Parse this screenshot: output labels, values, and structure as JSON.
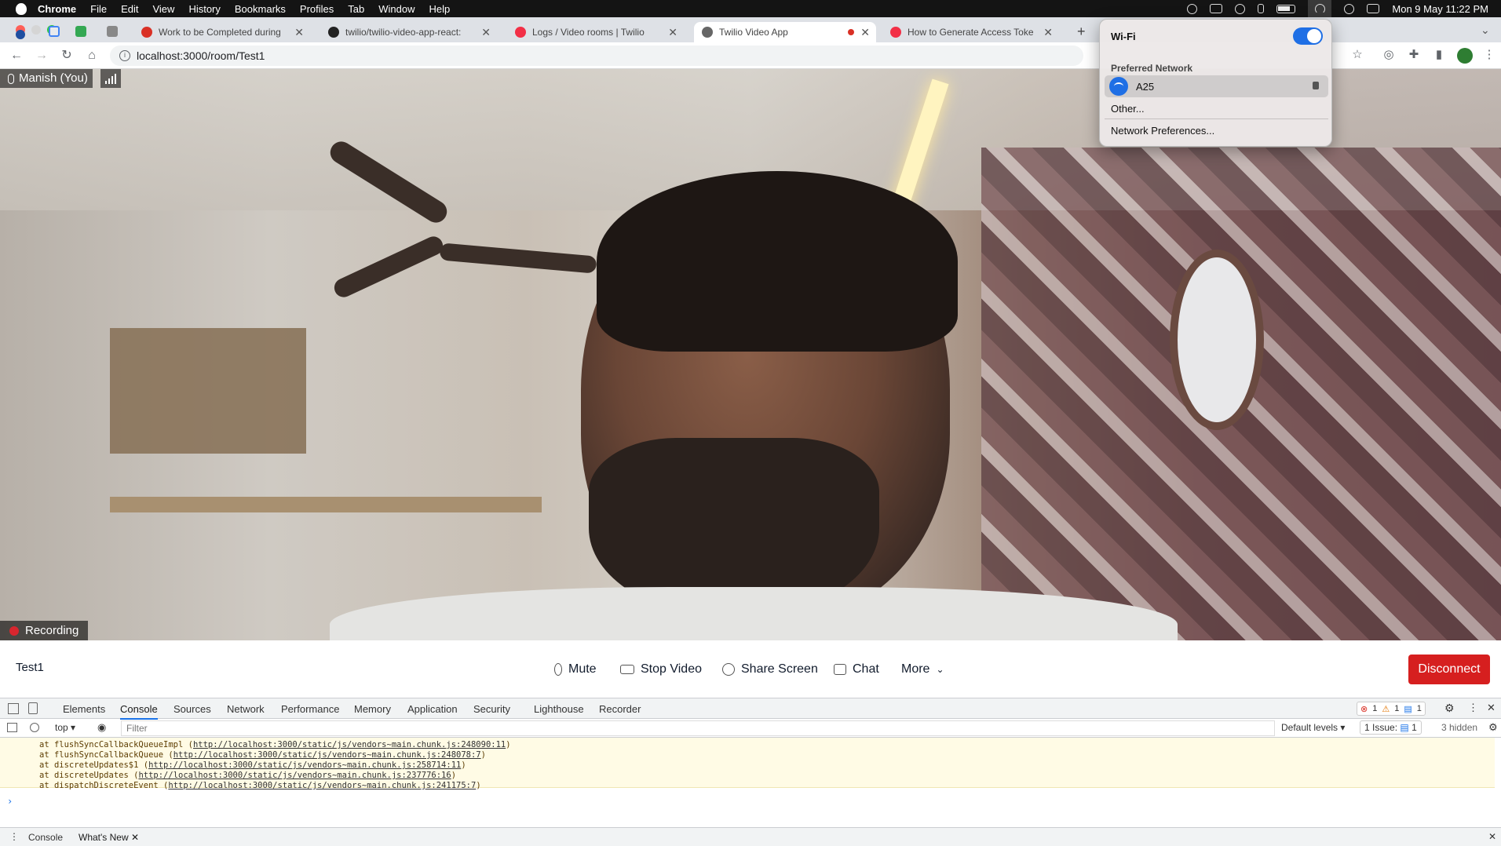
{
  "menubar": {
    "app_name": "Chrome",
    "menus": [
      "File",
      "Edit",
      "View",
      "History",
      "Bookmarks",
      "Profiles",
      "Tab",
      "Window",
      "Help"
    ],
    "datetime": "Mon 9 May  11:22 PM"
  },
  "browser": {
    "tabs": [
      {
        "title": "Work to be Completed during"
      },
      {
        "title": "twilio/twilio-video-app-react:"
      },
      {
        "title": "Logs / Video rooms | Twilio"
      },
      {
        "title": "Twilio Video App"
      },
      {
        "title": "How to Generate Access Toke"
      }
    ],
    "url": "localhost:3000/room/Test1"
  },
  "wifi_menu": {
    "title": "Wi-Fi",
    "enabled": true,
    "section_label": "Preferred Network",
    "network_name": "A25",
    "other_label": "Other...",
    "preferences_label": "Network Preferences..."
  },
  "video": {
    "participant_label": "Manish (You)",
    "recording_label": "Recording"
  },
  "controls": {
    "room_name": "Test1",
    "mute": "Mute",
    "stop_video": "Stop Video",
    "share_screen": "Share Screen",
    "chat": "Chat",
    "more": "More",
    "disconnect": "Disconnect"
  },
  "devtools": {
    "tabs": [
      "Elements",
      "Console",
      "Sources",
      "Network",
      "Performance",
      "Memory",
      "Application",
      "Security",
      "Lighthouse",
      "Recorder"
    ],
    "errors": "1",
    "warnings": "1",
    "messages": "1",
    "context": "top",
    "filter_placeholder": "Filter",
    "levels": "Default levels",
    "issues": "1 Issue:",
    "issues_count": "1",
    "hidden": "3 hidden",
    "stack": [
      {
        "prefix": "at flushSyncCallbackQueueImpl (",
        "link": "http://localhost:3000/static/js/vendors~main.chunk.js:248090:11",
        "suffix": ")"
      },
      {
        "prefix": "at flushSyncCallbackQueue (",
        "link": "http://localhost:3000/static/js/vendors~main.chunk.js:248078:7",
        "suffix": ")"
      },
      {
        "prefix": "at discreteUpdates$1 (",
        "link": "http://localhost:3000/static/js/vendors~main.chunk.js:258714:11",
        "suffix": ")"
      },
      {
        "prefix": "at discreteUpdates (",
        "link": "http://localhost:3000/static/js/vendors~main.chunk.js:237776:16",
        "suffix": ")"
      },
      {
        "prefix": "at dispatchDiscreteEvent (",
        "link": "http://localhost:3000/static/js/vendors~main.chunk.js:241175:7",
        "suffix": ")"
      }
    ],
    "drawer_tabs": [
      "Console",
      "What's New"
    ]
  }
}
